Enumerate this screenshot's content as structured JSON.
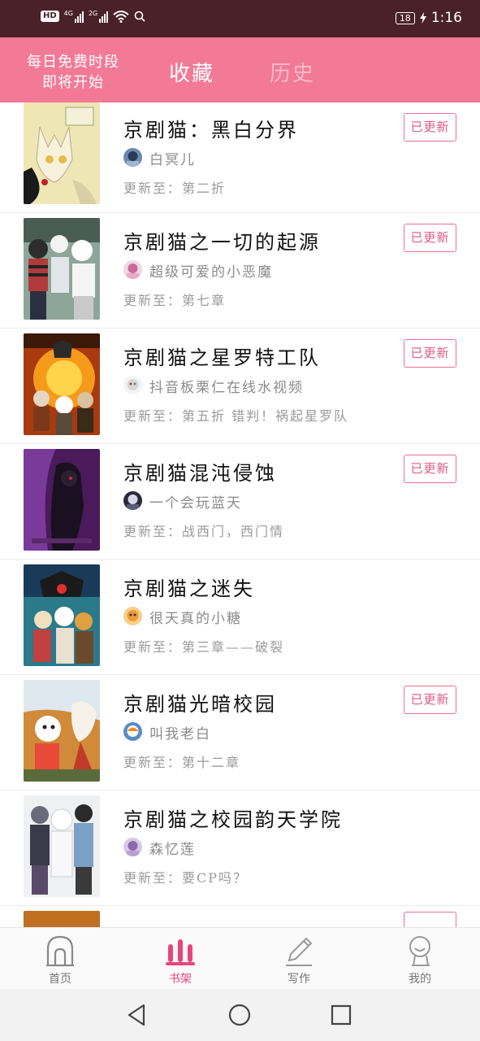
{
  "status_bar": {
    "hd_label": "HD",
    "sim1_label": "4G",
    "sim2_label": "2G",
    "battery_level": "18",
    "time": "1:16"
  },
  "header": {
    "promo_line1": "每日免费时段",
    "promo_line2": "即将开始",
    "tab_favorites": "收藏",
    "tab_history": "历史"
  },
  "books": [
    {
      "title": "京剧猫：黑白分界",
      "author": "白冥儿",
      "update": "更新至：第二折",
      "badge": "已更新"
    },
    {
      "title": "京剧猫之一切的起源",
      "author": "超级可爱的小恶魔",
      "update": "更新至：第七章",
      "badge": "已更新"
    },
    {
      "title": "京剧猫之星罗特工队",
      "author": "抖音板栗仁在线水视频",
      "update": "更新至：第五折 错判！祸起星罗队",
      "badge": "已更新"
    },
    {
      "title": "京剧猫混沌侵蚀",
      "author": "一个会玩蓝天",
      "update": "更新至：战西门，西门情",
      "badge": "已更新"
    },
    {
      "title": "京剧猫之迷失",
      "author": "很天真的小糖",
      "update": "更新至：第三章——破裂",
      "badge": ""
    },
    {
      "title": "京剧猫光暗校园",
      "author": "叫我老白",
      "update": "更新至：第十二章",
      "badge": "已更新"
    },
    {
      "title": "京剧猫之校园韵天学院",
      "author": "森忆莲",
      "update": "更新至：要CP吗？",
      "badge": ""
    }
  ],
  "partial_row": {
    "badge": ""
  },
  "bottom_nav": {
    "home": "首页",
    "shelf": "书架",
    "write": "写作",
    "mine": "我的",
    "active": "shelf",
    "accent_color": "#e8457a"
  },
  "icons": {
    "home": "home-arch-icon",
    "shelf": "bookshelf-bars-icon",
    "write": "pencil-icon",
    "mine": "person-bust-icon",
    "back": "back-triangle-icon",
    "sys_home": "home-circle-icon",
    "recent": "recent-square-icon"
  },
  "colors": {
    "status_bar": "#4a2128",
    "header": "#f27a96",
    "badge_border": "#ee6f92",
    "badge_text": "#e05a80"
  }
}
